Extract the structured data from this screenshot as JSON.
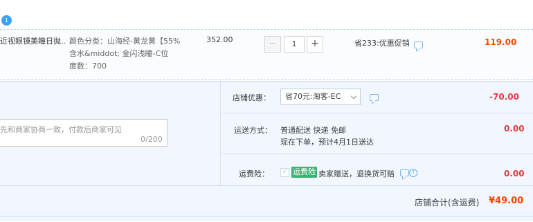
{
  "item": {
    "title": "近视眼镜美瞳日抛...",
    "sku_line1": "颜色分类：山海经-黄龙黄【55%",
    "sku_line2": "含水&middot; 金闪浅瞳-C位",
    "sku_line3": "度数：700",
    "price": "352.00",
    "qty_minus": "−",
    "qty_value": "1",
    "qty_plus": "+",
    "promo": "省233:优惠促销",
    "sum": "119.00"
  },
  "shop": {
    "message_placeholder": "先和商家协商一致，付款后商家可见",
    "message_count": "0/200",
    "discount_label": "店铺优惠：",
    "discount_selected": "省70元:淘客-EC",
    "discount_amount": "-70.00",
    "shipping_label": "运送方式：",
    "shipping_method": "普通配送 快递 免邮",
    "shipping_eta": "现在下单，预计4月1日送达",
    "shipping_amount": "0.00",
    "insurance_label": "运费险：",
    "insurance_badge": "运费险",
    "insurance_text": "卖家赠送，退换货可赔",
    "insurance_amount": "0.00",
    "total_label": "店铺合计(含运费)",
    "total_value": "¥49.00"
  },
  "icons": {
    "top": "notification-icon",
    "chat": "chat-bubble-icon",
    "help": "question-circle-icon"
  },
  "colors": {
    "price_red": "#ff4400",
    "badge_green": "#3cb371",
    "shop_bg": "#f2f7ff"
  }
}
